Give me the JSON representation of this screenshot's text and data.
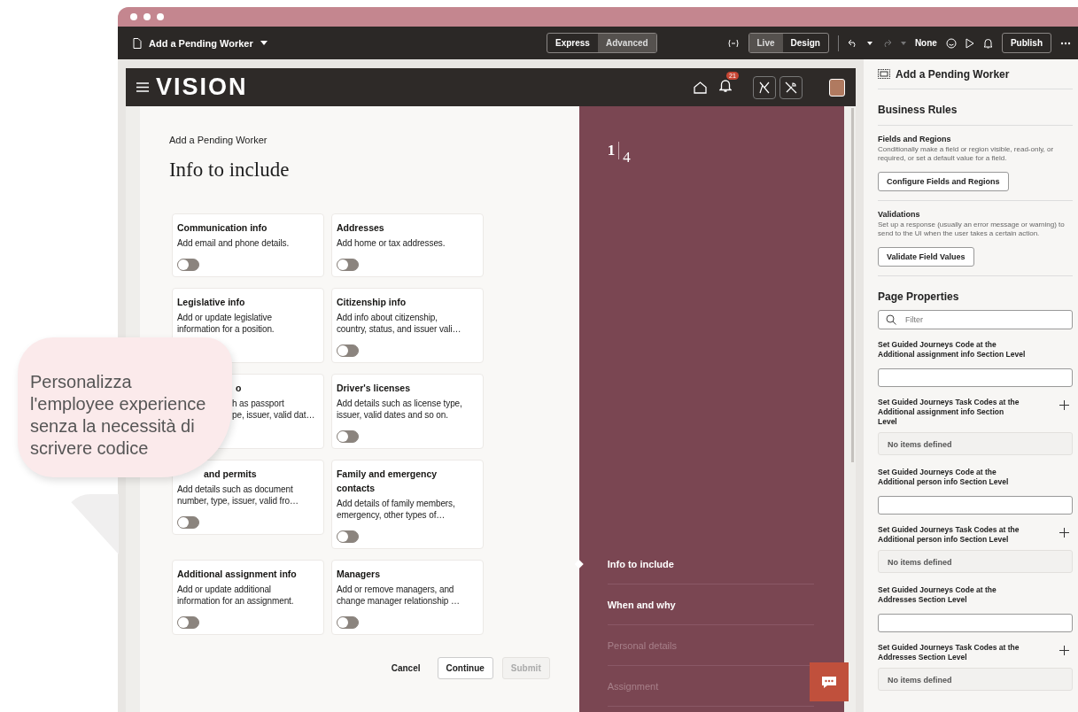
{
  "toolbar": {
    "title": "Add a Pending Worker",
    "modes": [
      {
        "label": "Express",
        "selected": false
      },
      {
        "label": "Advanced",
        "selected": true
      }
    ],
    "views": [
      {
        "label": "Live",
        "selected": true
      },
      {
        "label": "Design",
        "selected": false
      }
    ],
    "sandbox": "None",
    "publish": "Publish"
  },
  "app": {
    "logo": "VISION",
    "notifications": "21",
    "breadcrumb": "Add a Pending Worker",
    "heading": "Info to include",
    "cards": [
      {
        "kind": "card",
        "title": "Communication info",
        "description": "Add email and phone details.",
        "toggle": {
          "on": false
        }
      },
      {
        "kind": "card",
        "title": "Addresses",
        "description": "Add home or tax addresses.",
        "toggle": {
          "on": false
        }
      },
      {
        "kind": "card",
        "title": "Legislative info",
        "description": "Add or update legislative\ninformation for a position."
      },
      {
        "kind": "card",
        "title": "Citizenship info",
        "description": "Add info about citizenship,\ncountry, status, and issuer vali…",
        "toggle": {
          "on": false
        }
      },
      {
        "kind": "covered",
        "title": "o",
        "description": "h as passport\npe, issuer, valid dat…"
      },
      {
        "kind": "card",
        "title": "Driver's licenses",
        "description": "Add details such as license type,\nissuer, valid dates and so on.",
        "toggle": {
          "on": false
        }
      },
      {
        "kind": "covered_title",
        "title": "and permits",
        "description": "Add details such as document\nnumber, type, issuer, valid fro…",
        "toggle": {
          "on": false
        }
      },
      {
        "kind": "card",
        "title": "Family and emergency\ncontacts",
        "description": "Add details of family members,\nemergency, other types of…",
        "toggle": {
          "on": false
        }
      },
      {
        "kind": "card",
        "title": "Additional assignment info",
        "description": "Add or update additional\ninformation for an assignment.",
        "toggle": {
          "on": false
        }
      },
      {
        "kind": "card",
        "title": "Managers",
        "description": "Add or remove managers, and\nchange manager relationship …",
        "toggle": {
          "on": false
        }
      }
    ],
    "buttons": [
      {
        "kind": "link",
        "label": "Cancel",
        "disabled": false
      },
      {
        "kind": "outline",
        "label": "Continue",
        "disabled": false
      },
      {
        "kind": "outline",
        "label": "Submit",
        "disabled": true
      }
    ],
    "step_current": "1",
    "step_total": "4",
    "steps": [
      {
        "label": "Info to include",
        "selected": true,
        "disabled": false
      },
      {
        "label": "When and why",
        "selected": false,
        "disabled": false
      },
      {
        "label": "Personal details",
        "selected": false,
        "disabled": true
      },
      {
        "label": "Assignment",
        "selected": false,
        "disabled": true
      }
    ]
  },
  "callout": {
    "text": "Personalizza\nl'employee experience\nsenza la necessità di\nscrivere codice"
  },
  "panel": {
    "title": "Add a Pending Worker",
    "business_rules": {
      "heading": "Business Rules",
      "groups": [
        {
          "title": "Fields and Regions",
          "description": "Conditionally make a field or region visible, read-only, or required, or set a default value for a field.",
          "button": "Configure Fields and Regions"
        },
        {
          "title": "Validations",
          "description": "Set up a response (usually an error message or warning) to send to the UI when the user takes a certain action.",
          "button": "Validate Field Values"
        }
      ]
    },
    "page_properties": {
      "heading": "Page Properties",
      "filter_placeholder": "Filter",
      "properties": [
        {
          "kind": "text",
          "label": "Set Guided Journeys Code at the\nAdditional assignment info Section Level"
        },
        {
          "kind": "list",
          "label": "Set Guided Journeys Task Codes at the\nAdditional assignment info Section\nLevel",
          "empty_text": "No items defined"
        },
        {
          "kind": "text",
          "label": "Set Guided Journeys Code at the\nAdditional person info Section Level"
        },
        {
          "kind": "list",
          "label": "Set Guided Journeys Task Codes at the\nAdditional person info Section Level",
          "empty_text": "No items defined"
        },
        {
          "kind": "text",
          "label": "Set Guided Journeys Code at the\nAddresses Section Level"
        },
        {
          "kind": "list",
          "label": "Set Guided Journeys Task Codes at the\nAddresses Section Level",
          "empty_text": "No items defined"
        }
      ]
    }
  }
}
